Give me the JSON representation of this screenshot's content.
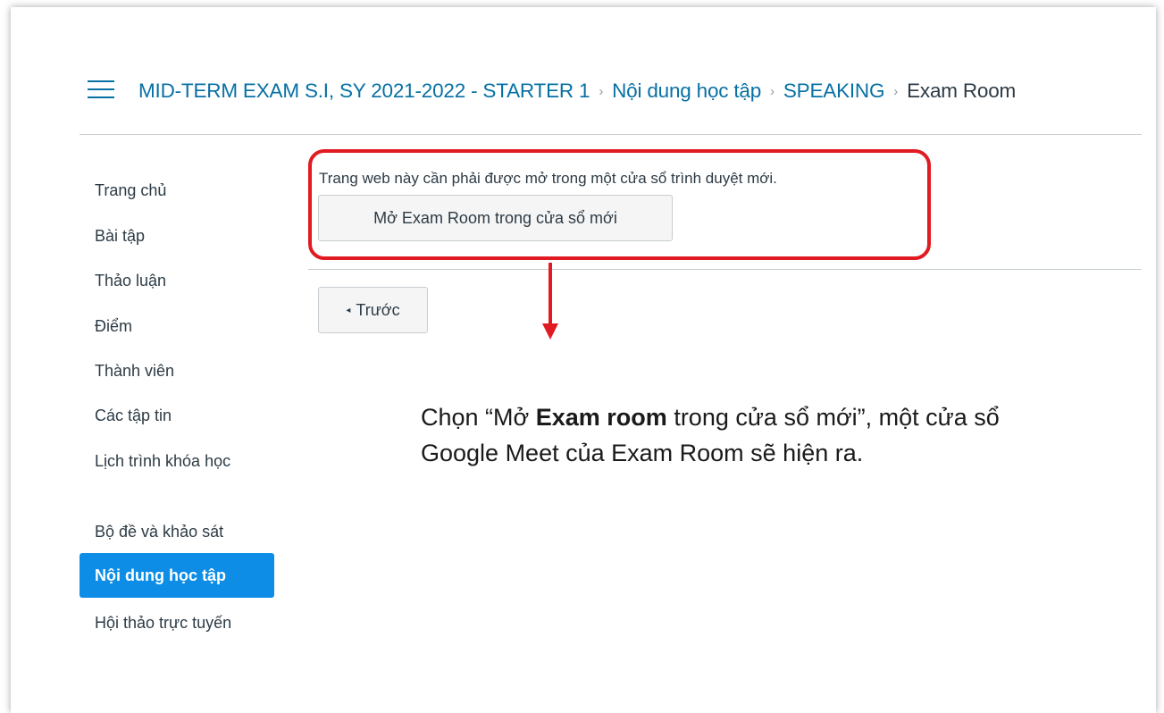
{
  "breadcrumb": {
    "items": [
      {
        "label": "MID-TERM EXAM S.I, SY 2021-2022 - STARTER 1"
      },
      {
        "label": "Nội dung học tập"
      },
      {
        "label": "SPEAKING"
      }
    ],
    "current": "Exam Room",
    "separator": "›"
  },
  "sidebar": {
    "items": [
      {
        "label": "Trang chủ"
      },
      {
        "label": "Bài tập"
      },
      {
        "label": "Thảo luận"
      },
      {
        "label": "Điểm"
      },
      {
        "label": "Thành viên"
      },
      {
        "label": "Các tập tin"
      },
      {
        "label": "Lịch trình khóa học"
      },
      {
        "label": "Bộ đề và khảo sát"
      },
      {
        "label": "Nội dung học tập",
        "active": true
      },
      {
        "label": "Hội thảo trực tuyến"
      }
    ]
  },
  "content": {
    "notice": "Trang web này cần phải được mở trong một cửa sổ trình duyệt mới.",
    "open_button": "Mở Exam Room trong cửa sổ mới",
    "prev_button": "Trước",
    "prev_icon": "◂"
  },
  "annotation": {
    "part1": "Chọn “Mở ",
    "bold": "Exam room",
    "part2": " trong cửa sổ mới”, một cửa sổ Google Meet của Exam Room sẽ hiện ra."
  },
  "colors": {
    "link": "#0770a3",
    "active_nav": "#0e8de6",
    "highlight": "#e11b22"
  }
}
